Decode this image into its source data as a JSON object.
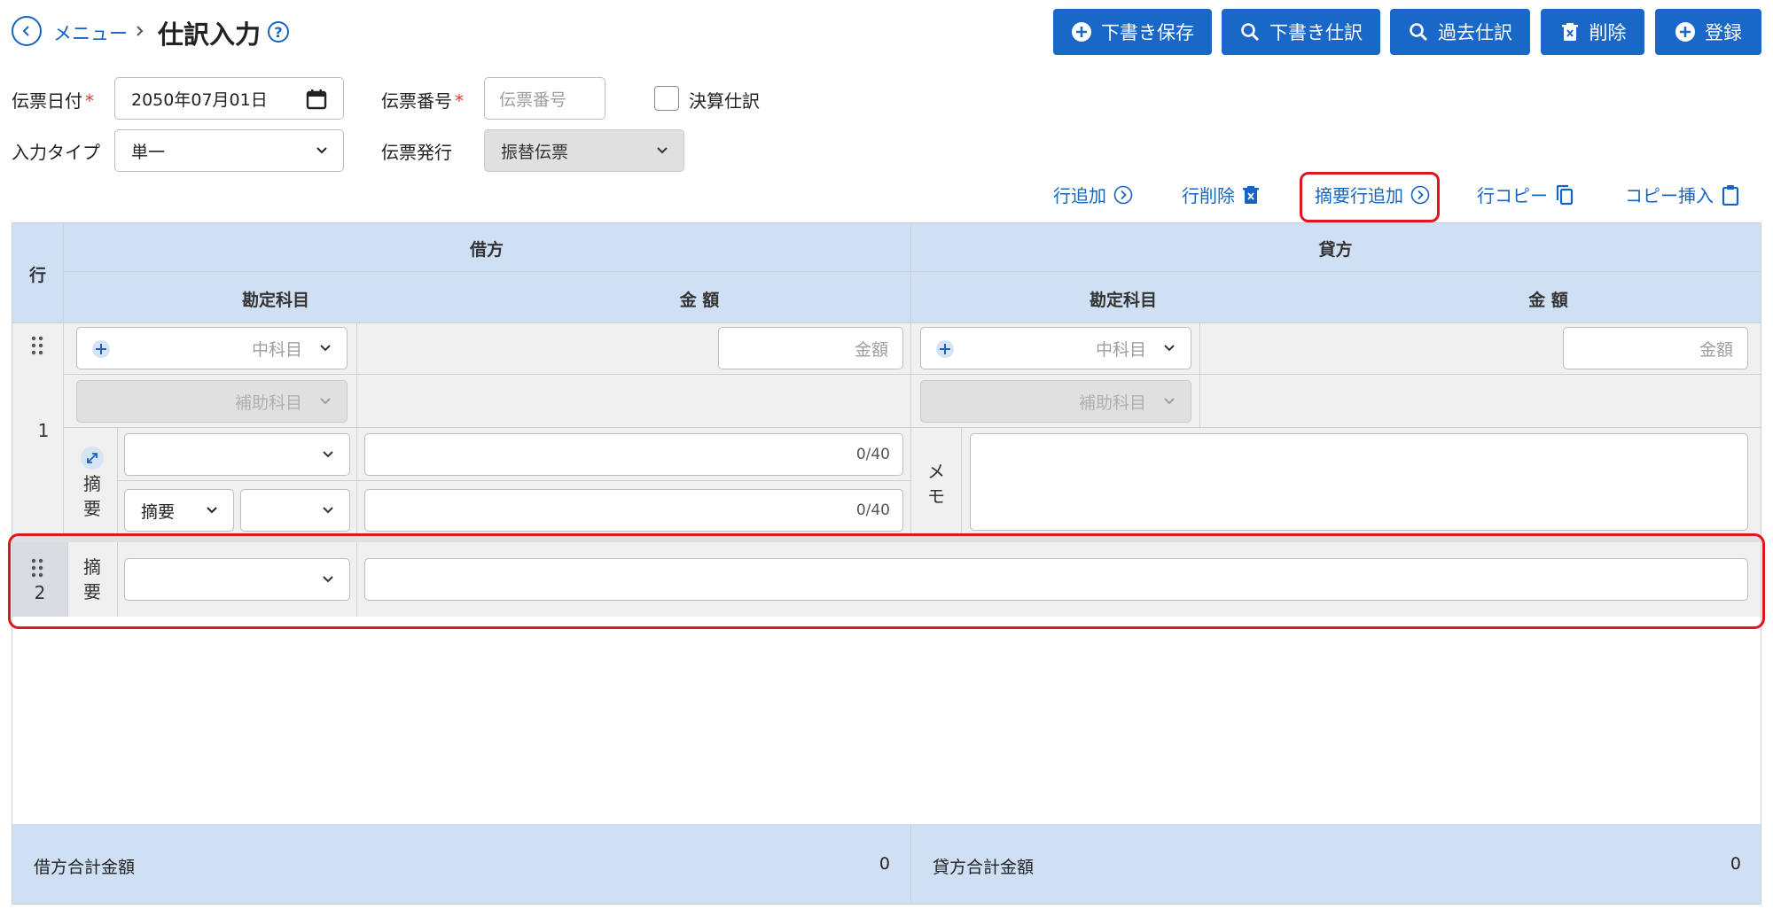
{
  "header": {
    "back_label": "メニュー",
    "title": "仕訳入力"
  },
  "toolbar": {
    "draft_save": "下書き保存",
    "draft_journal": "下書き仕訳",
    "past_journal": "過去仕訳",
    "delete": "削除",
    "register": "登録"
  },
  "form": {
    "date_label": "伝票日付",
    "date_value": "2050年07月01日",
    "number_label": "伝票番号",
    "number_placeholder": "伝票番号",
    "closing_label": "決算仕訳",
    "input_type_label": "入力タイプ",
    "input_type_value": "単一",
    "issue_label": "伝票発行",
    "issue_value": "振替伝票"
  },
  "row_actions": {
    "add_row": "行追加",
    "delete_row": "行削除",
    "add_summary_row": "摘要行追加",
    "copy_row": "行コピー",
    "copy_insert": "コピー挿入"
  },
  "table": {
    "row_header": "行",
    "debit_header": "借方",
    "credit_header": "貸方",
    "account_header": "勘定科目",
    "amount_header": "金 額",
    "middle_account_placeholder": "中科目",
    "sub_account_placeholder": "補助科目",
    "amount_placeholder": "金額",
    "summary_label_1": "摘",
    "summary_label_2": "要",
    "memo_label_1": "メ",
    "memo_label_2": "モ",
    "summary_select_value": "摘要",
    "counter_1": "0/40",
    "counter_2": "0/40",
    "rows": [
      {
        "number": "1"
      },
      {
        "number": "2"
      }
    ]
  },
  "totals": {
    "debit_label": "借方合計金額",
    "debit_value": "0",
    "credit_label": "貸方合計金額",
    "credit_value": "0"
  },
  "colors": {
    "primary": "#1967c6",
    "header_bg": "#cfe0f5",
    "highlight": "#e0161e"
  }
}
